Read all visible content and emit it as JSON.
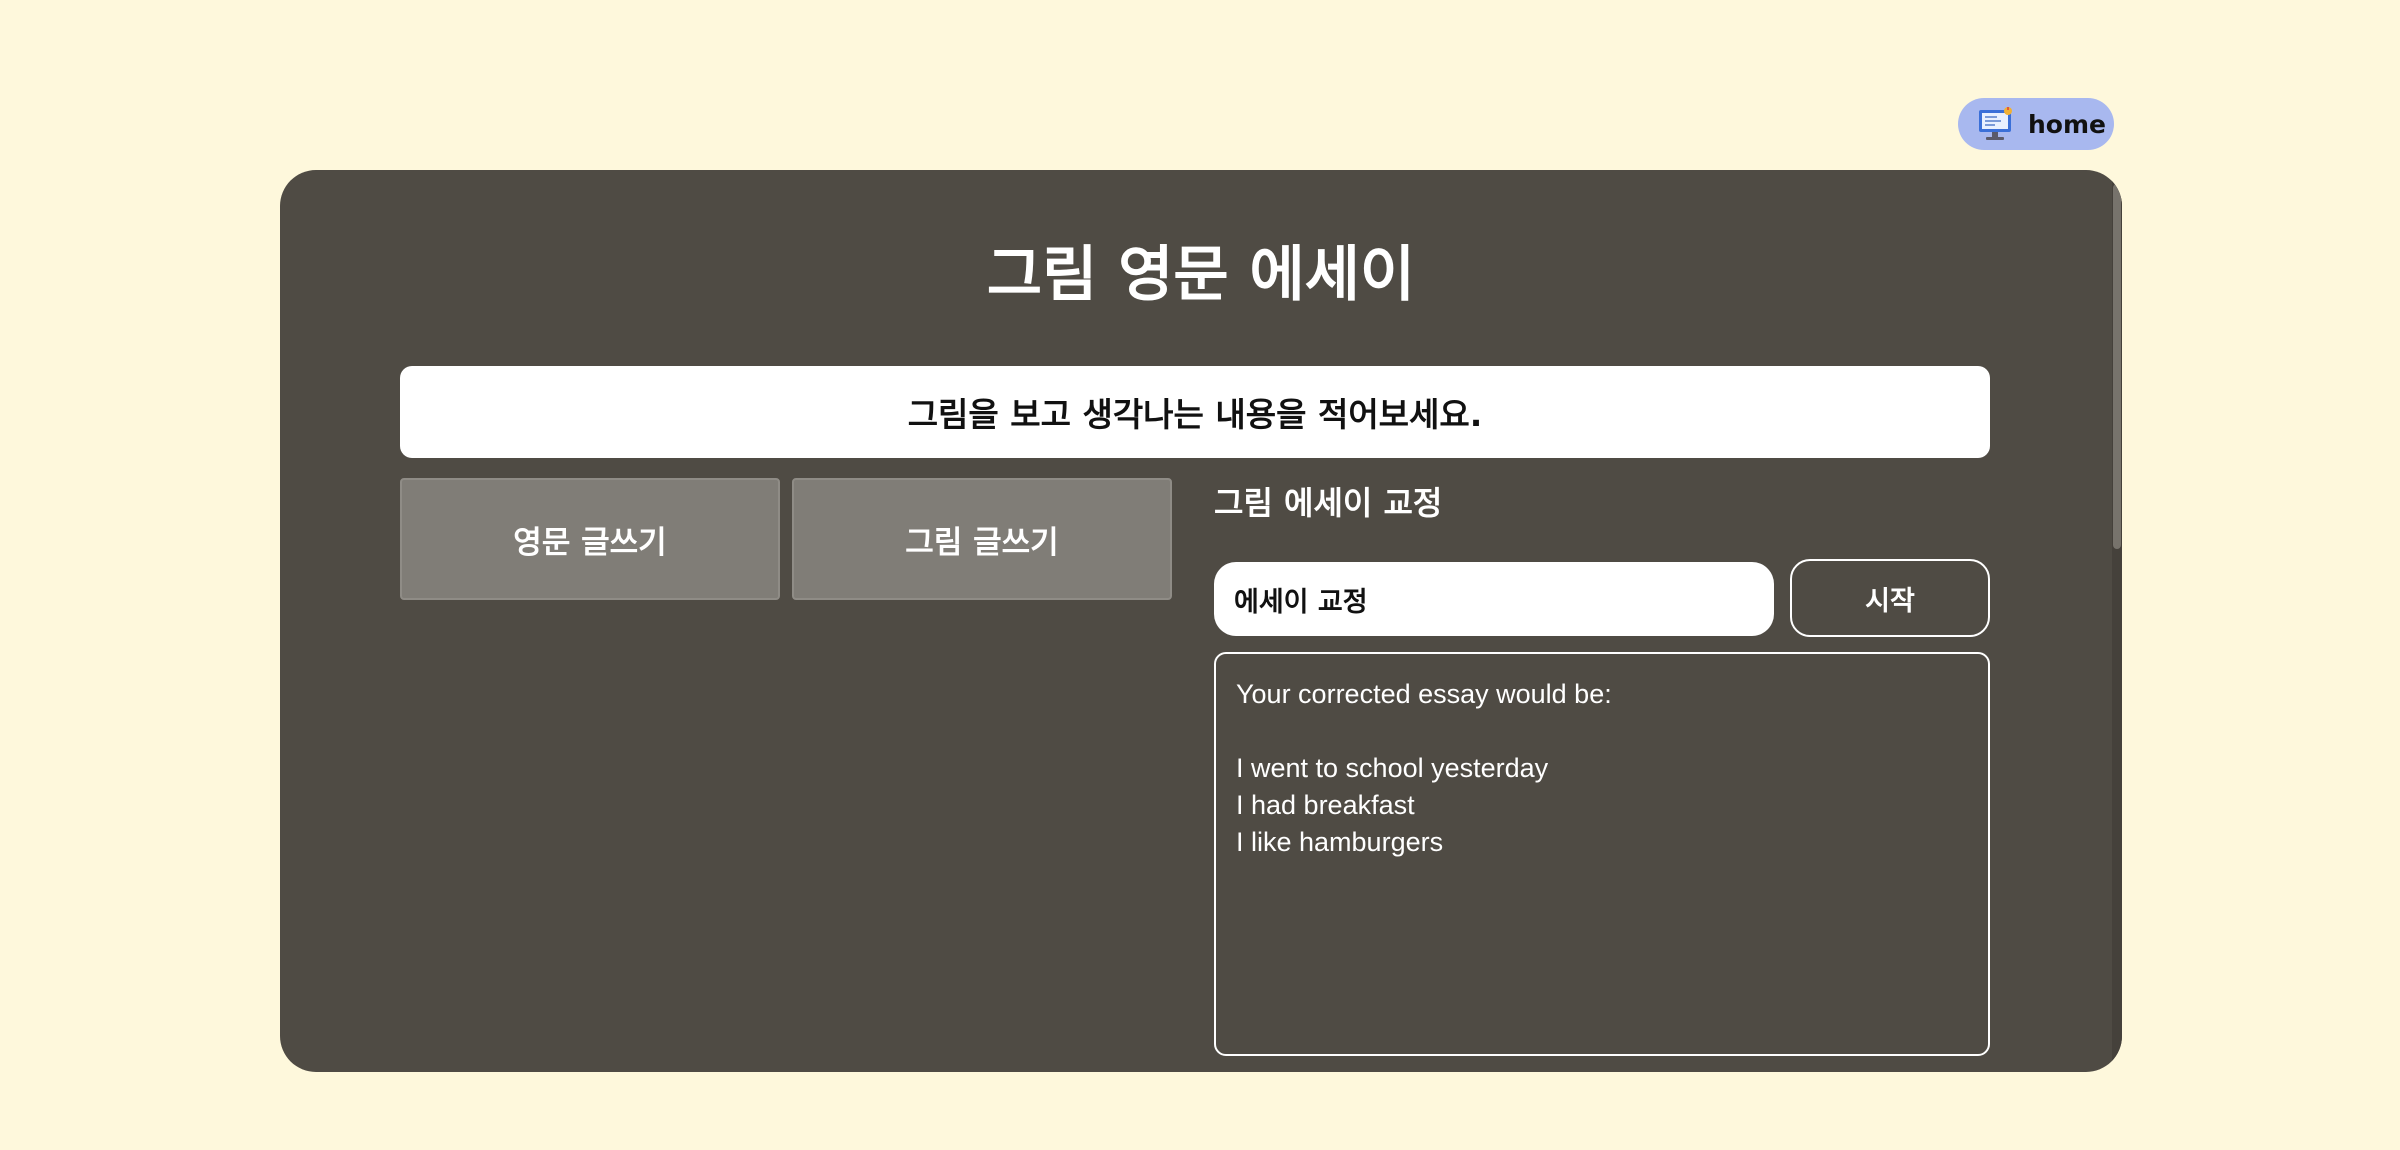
{
  "home": {
    "label": "home",
    "icon": "monitor-icon"
  },
  "page": {
    "title": "그림 영문 에세이",
    "instruction": "그림을 보고 생각나는 내용을 적어보세요."
  },
  "modes": [
    {
      "label": "영문 글쓰기"
    },
    {
      "label": "그림 글쓰기"
    }
  ],
  "correction": {
    "section_label": "그림 에세이 교정",
    "input_value": "에세이 교정",
    "start_label": "시작",
    "result_lines": [
      "Your corrected essay would be:",
      "",
      "I went to school yesterday",
      "I had breakfast",
      "I like hamburgers"
    ]
  },
  "colors": {
    "background": "#fef8dc",
    "panel": "#4f4b44",
    "home_button": "#a8b8ef",
    "mode_button": "#807d77"
  }
}
